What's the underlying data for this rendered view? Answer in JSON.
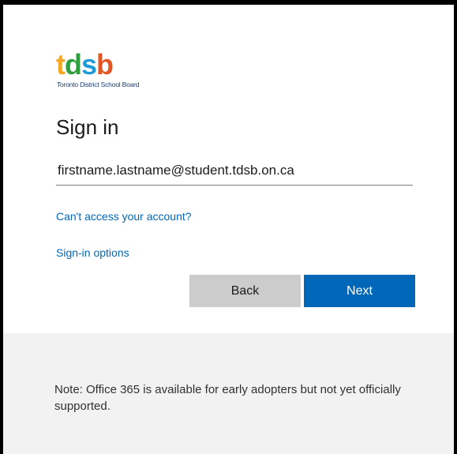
{
  "brand": {
    "logo_letters": [
      {
        "char": "t",
        "color": "#f5a623"
      },
      {
        "char": "d",
        "color": "#2e9e3f"
      },
      {
        "char": "s",
        "color": "#1f9bd6"
      },
      {
        "char": "b",
        "color": "#e35525"
      }
    ],
    "subtitle": "Toronto District School Board"
  },
  "signin": {
    "title": "Sign in",
    "email_value": "firstname.lastname@student.tdsb.on.ca",
    "cant_access_link": "Can't access your account?",
    "signin_options_link": "Sign-in options",
    "back_label": "Back",
    "next_label": "Next"
  },
  "footer": {
    "note": "Note: Office 365 is available for early adopters but not yet officially supported."
  },
  "colors": {
    "accent": "#0067b8",
    "back_button": "#cccccc",
    "footer_background": "#f2f2f2"
  }
}
